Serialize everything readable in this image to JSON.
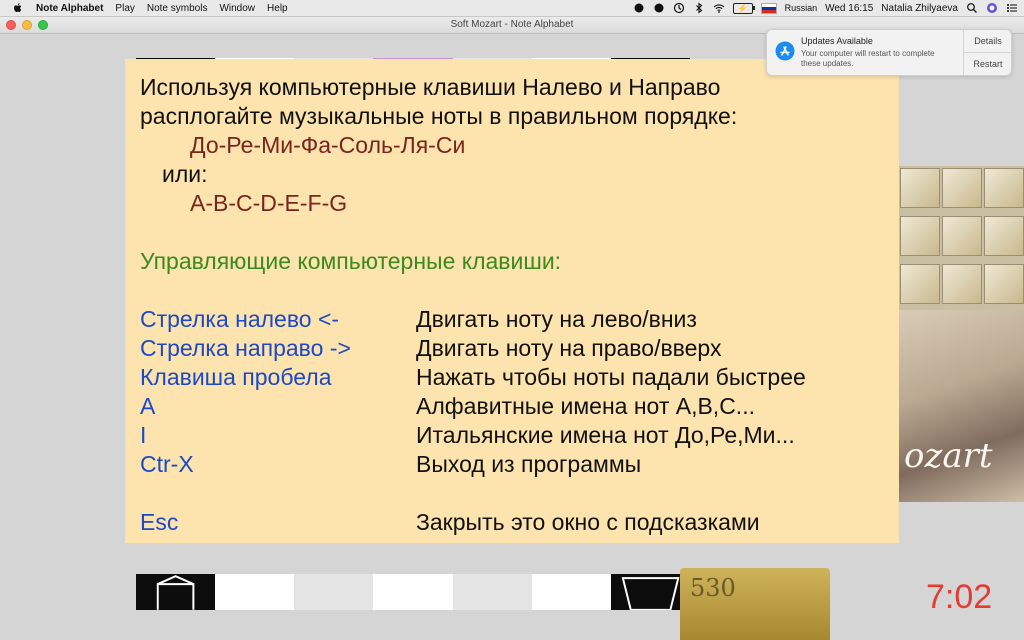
{
  "menubar": {
    "items": [
      "Note Alphabet",
      "Play",
      "Note symbols",
      "Window",
      "Help"
    ],
    "status": {
      "input_source": "Russian",
      "clock": "Wed 16:15",
      "user": "Natalia Zhilyaeva"
    }
  },
  "window": {
    "title": "Soft Mozart - Note Alphabet"
  },
  "notification": {
    "title": "Updates Available",
    "message": "Your computer will restart to complete these updates.",
    "details_label": "Details",
    "restart_label": "Restart"
  },
  "game": {
    "score": "530",
    "signature": "ozart",
    "timer": "7:02"
  },
  "help": {
    "intro_line1": "Используя компьютерные клавиши Налево и Направо",
    "intro_line2": "расплогайте музыкальные ноты в правильном порядке:",
    "sequence_solfege": "До-Ре-Ми-Фа-Соль-Ля-Си",
    "or_label": "или:",
    "sequence_letters": "A-B-C-D-E-F-G",
    "controls_heading": "Управляющие компьютерные клавиши:",
    "controls": [
      {
        "key": "Стрелка налево <-",
        "desc": "Двигать ноту на лево/вниз"
      },
      {
        "key": "Стрелка направо ->",
        "desc": "Двигать ноту на право/вверх"
      },
      {
        "key": "Клавиша пробела",
        "desc": "Нажать чтобы ноты падали быстрее"
      },
      {
        "key": "A",
        "desc": "Алфавитные имена нот A,B,C..."
      },
      {
        "key": "I",
        "desc": "Итальянские имена нот До,Ре,Ми..."
      },
      {
        "key": "Ctr-X",
        "desc": "Выход из программы"
      }
    ],
    "close": {
      "key": "Esc",
      "desc": "Закрыть это окно с подсказками"
    }
  },
  "colors": {
    "help_bg": "#fde3ae",
    "key_blue": "#1c49c9",
    "heading_green": "#3b8a1e",
    "sequence_maroon": "#7a241c",
    "timer_red": "#e53b30"
  }
}
